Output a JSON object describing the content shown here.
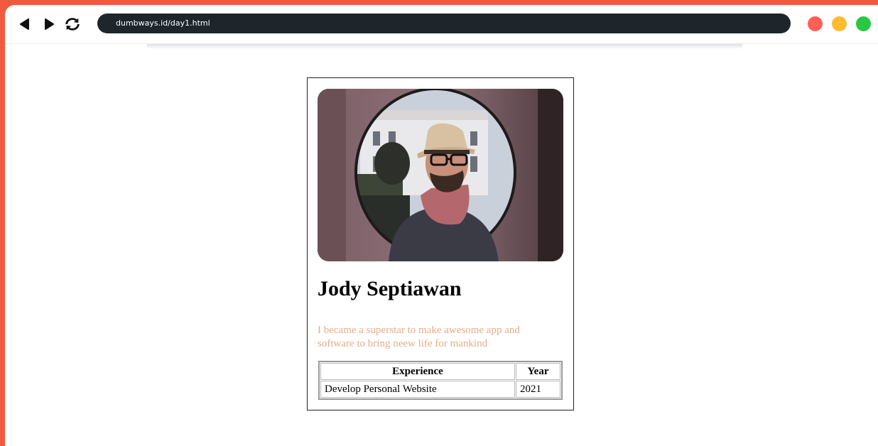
{
  "browser": {
    "url": "dumbways.id/day1.html",
    "back_icon": "back-arrow-icon",
    "forward_icon": "forward-arrow-icon",
    "reload_icon": "reload-icon",
    "window_controls": [
      {
        "name": "close",
        "color": "#ff5f57"
      },
      {
        "name": "minimize",
        "color": "#febc2e"
      },
      {
        "name": "maximize",
        "color": "#28c840"
      }
    ]
  },
  "profile": {
    "photo_alt": "Man with hat and glasses",
    "name": "Jody Septiawan",
    "bio": "I became a superstar to make awesome app and software to bring neew life for mankind",
    "bio_color": "#e3ad8a"
  },
  "experience_table": {
    "headers": [
      "Experience",
      "Year"
    ],
    "rows": [
      [
        "Develop Personal Website",
        "2021"
      ]
    ]
  }
}
